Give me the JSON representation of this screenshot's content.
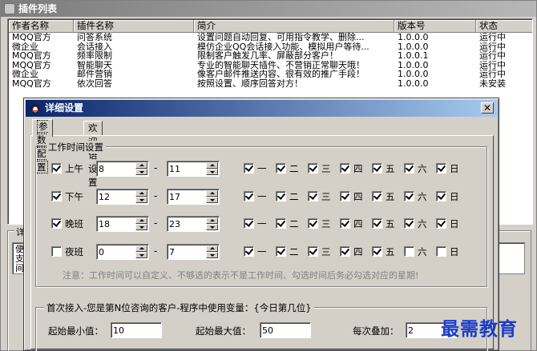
{
  "main_window": {
    "title": "插件列表"
  },
  "plugin_table": {
    "columns": [
      "作者名称",
      "插件名称",
      "简介",
      "版本号",
      "状态"
    ],
    "rows": [
      [
        "MQQ官方",
        "问答系统",
        "设置问题自动回复、可用指令教学、删除...",
        "1.0.0.0",
        "运行中"
      ],
      [
        "微企业",
        "会话接入",
        "模仿企业QQ会话接入功能、模拟用户等待...",
        "1.0.0.0",
        "运行中"
      ],
      [
        "MQQ官方",
        "频率限制",
        "限制客户触发几率、屏蔽部分客户！",
        "1.0.0.1",
        "运行中"
      ],
      [
        "MQQ官方",
        "智能聊天",
        "专业的智能聊天插件、不营销正常聊天哦！",
        "1.0.0.0",
        "运行中"
      ],
      [
        "微企业",
        "邮件营销",
        "像客户邮件推送内容、很有效的推广手段！",
        "1.0.0.0",
        "运行中"
      ],
      [
        "MQQ官方",
        "依次回答",
        "按照设置、顺序回答对方！",
        "1.0.0.0",
        "未安装"
      ]
    ]
  },
  "detail_panel": {
    "group_title": "详",
    "text": "便\n支\n间"
  },
  "dialog": {
    "title": "详细设置",
    "close_label": "✕",
    "tabs": [
      {
        "label": "参数配置",
        "active": true
      },
      {
        "label": "欢迎语设置",
        "active": false
      }
    ],
    "work_time": {
      "group_title": "工作时间设置",
      "separator": "-",
      "weekdays": [
        "一",
        "二",
        "三",
        "四",
        "五",
        "六",
        "日"
      ],
      "shifts": [
        {
          "label": "上午",
          "enabled": true,
          "start": "8",
          "end": "11",
          "days": [
            true,
            true,
            true,
            true,
            true,
            true,
            true
          ]
        },
        {
          "label": "下午",
          "enabled": true,
          "start": "12",
          "end": "17",
          "days": [
            true,
            true,
            true,
            true,
            true,
            true,
            true
          ]
        },
        {
          "label": "晚班",
          "enabled": true,
          "start": "18",
          "end": "23",
          "days": [
            true,
            true,
            true,
            true,
            true,
            true,
            true
          ]
        },
        {
          "label": "夜班",
          "enabled": false,
          "start": "0",
          "end": "7",
          "days": [
            true,
            true,
            true,
            true,
            true,
            false,
            false
          ]
        }
      ],
      "note": "注意：工作时间可以自定义、不够选的表示不是工作时间、勾选时间后务必勾选对应的星期!"
    },
    "first_access": {
      "group_title": "首次接入-您是第N位咨询的客户-程序中使用变量：{今日第几位}",
      "min_label": "起始最小值：",
      "min_value": "10",
      "max_label": "起始最大值：",
      "max_value": "50",
      "step_label": "每次叠加：",
      "step_value": "2"
    }
  },
  "watermark": "最需教育"
}
